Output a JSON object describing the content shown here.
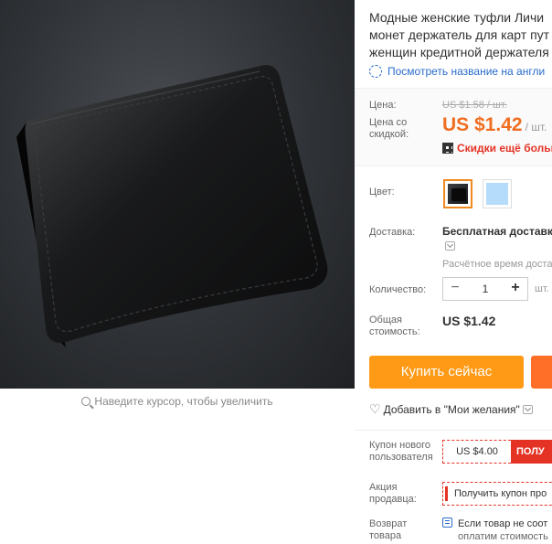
{
  "product": {
    "title_lines": [
      "Модные женские туфли Личи",
      "монет держатель для карт пут",
      "женщин кредитной держателя"
    ],
    "translate_link": "Посмотреть название на англи"
  },
  "zoom_hint": "Наведите курсор, чтобы увеличить",
  "price": {
    "price_label": "Цена:",
    "old_price": "US $1.58 / шт.",
    "discount_label_line1": "Цена со",
    "discount_label_line2": "скидкой:",
    "new_price": "US $1.42",
    "unit": "/ шт.",
    "discount_link": "Скидки ещё больш"
  },
  "color": {
    "label": "Цвет:",
    "options": [
      "black-wallet-swatch",
      "light-blue-swatch"
    ],
    "selected_index": 0,
    "colors": {
      "selected_border": "#f0891f",
      "blue": "#b6dcfb"
    }
  },
  "shipping": {
    "label": "Доставка:",
    "method": "Бесплатная доставка",
    "estimate": "Расчётное время достав"
  },
  "quantity": {
    "label": "Количество:",
    "minus": "−",
    "value": "1",
    "plus": "+",
    "unit": "шт."
  },
  "total": {
    "label_line1": "Общая",
    "label_line2": "стоимость:",
    "value": "US $1.42"
  },
  "actions": {
    "buy_now": "Купить сейчас",
    "wishlist": "Добавить в \"Мои желания\""
  },
  "coupons": {
    "new_user_label_line1": "Купон нового",
    "new_user_label_line2": "пользователя",
    "new_user_amount": "US $4.00",
    "new_user_get": "ПОЛУ",
    "seller_promo_label_line1": "Акция",
    "seller_promo_label_line2": "продавца:",
    "seller_promo_button": "Получить купон про"
  },
  "returns": {
    "label_line1": "Возврат",
    "label_line2": "товара",
    "line1": "Если товар не соот",
    "line2": "оплатим стоимость"
  },
  "theme": {
    "accent_orange": "#ff9a16",
    "price_orange": "#f06d1f",
    "discount_red": "#e43225",
    "link_blue": "#2a6ccc"
  }
}
